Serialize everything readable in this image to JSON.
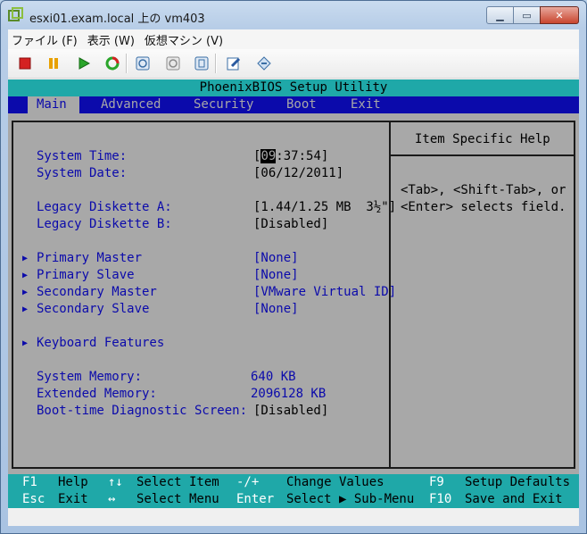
{
  "window": {
    "title": "esxi01.exam.local 上の vm403"
  },
  "menubar": {
    "items": [
      {
        "label": "ファイル (F)"
      },
      {
        "label": "表示 (W)"
      },
      {
        "label": "仮想マシン (V)"
      }
    ]
  },
  "toolbar": {
    "buttons": [
      "power-off",
      "suspend",
      "power-on",
      "reset",
      "take-snapshot",
      "revert-snapshot",
      "snapshot-manager",
      "edit-settings",
      "install-tools"
    ]
  },
  "bios": {
    "title": "PhoenixBIOS Setup Utility",
    "menu": [
      {
        "label": "Main",
        "active": true
      },
      {
        "label": "Advanced"
      },
      {
        "label": "Security"
      },
      {
        "label": "Boot"
      },
      {
        "label": "Exit"
      }
    ],
    "main": {
      "system_time_label": "System Time:",
      "system_time_hour": "09",
      "system_time_rest": ":37:54]",
      "system_date_label": "System Date:",
      "system_date_value": "[06/12/2011]",
      "diskette_a_label": "Legacy Diskette A:",
      "diskette_a_value": "[1.44/1.25 MB  3½\"]",
      "diskette_b_label": "Legacy Diskette B:",
      "diskette_b_value": "[Disabled]",
      "primary_master_label": "Primary Master",
      "primary_master_value": "[None]",
      "primary_slave_label": "Primary Slave",
      "primary_slave_value": "[None]",
      "secondary_master_label": "Secondary Master",
      "secondary_master_value": "[VMware Virtual ID]",
      "secondary_slave_label": "Secondary Slave",
      "secondary_slave_value": "[None]",
      "keyboard_label": "Keyboard Features",
      "system_memory_label": "System Memory:",
      "system_memory_value": "640 KB",
      "extended_memory_label": "Extended Memory:",
      "extended_memory_value": "2096128 KB",
      "boot_diag_label": "Boot-time Diagnostic Screen:",
      "boot_diag_value": "[Disabled]"
    },
    "help": {
      "title": "Item Specific Help",
      "line1": "<Tab>, <Shift-Tab>, or",
      "line2": "<Enter> selects field."
    },
    "footer": {
      "f1_key": "F1",
      "f1_desc": "Help",
      "arrows_ud_key": "↑↓",
      "arrows_ud_desc": "Select Item",
      "minus_plus_key": "-/+",
      "minus_plus_desc": "Change Values",
      "f9_key": "F9",
      "f9_desc": "Setup Defaults",
      "esc_key": "Esc",
      "esc_desc": "Exit",
      "arrows_lr_key": "↔",
      "arrows_lr_desc": "Select Menu",
      "enter_key": "Enter",
      "enter_desc": "Select ▶ Sub-Menu",
      "f10_key": "F10",
      "f10_desc": "Save and Exit"
    }
  },
  "colors": {
    "bios_bg": "#a8a8a8",
    "bios_blue": "#0b0aab",
    "bios_cyan": "#1fa8a8"
  }
}
